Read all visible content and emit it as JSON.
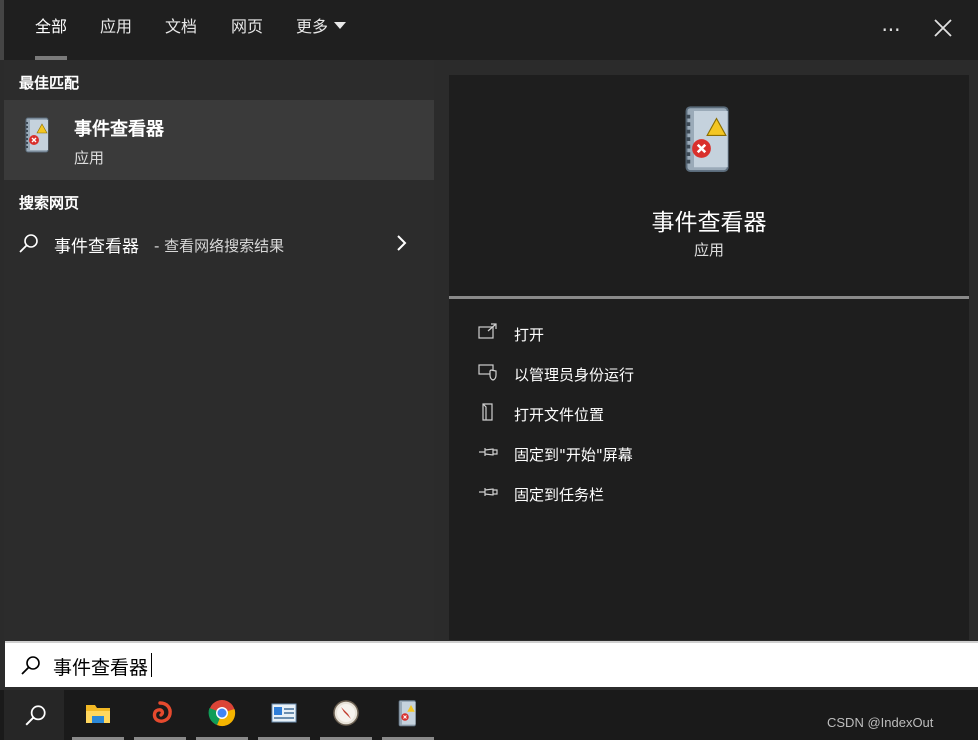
{
  "tabs": [
    {
      "label": "全部"
    },
    {
      "label": "应用"
    },
    {
      "label": "文档"
    },
    {
      "label": "网页"
    },
    {
      "label": "更多"
    }
  ],
  "top_actions": {
    "more_icon": "more-dots-icon",
    "close_icon": "close-icon",
    "more_glyph": "···",
    "close_glyph": "✕"
  },
  "left": {
    "best_match_heading": "最佳匹配",
    "best_match": {
      "title": "事件查看器",
      "subtitle": "应用",
      "icon": "event-viewer-icon"
    },
    "web_heading": "搜索网页",
    "web_result": {
      "title": "事件查看器",
      "subtitle": "- 查看网络搜索结果"
    }
  },
  "detail": {
    "title": "事件查看器",
    "subtitle": "应用",
    "actions": [
      {
        "label": "打开",
        "icon": "open-icon"
      },
      {
        "label": "以管理员身份运行",
        "icon": "admin-shield-icon"
      },
      {
        "label": "打开文件位置",
        "icon": "file-location-icon"
      },
      {
        "label": "固定到\"开始\"屏幕",
        "icon": "pin-icon"
      },
      {
        "label": "固定到任务栏",
        "icon": "pin-icon"
      }
    ]
  },
  "search": {
    "value": "事件查看器"
  },
  "taskbar": {
    "apps": [
      "file-explorer-icon",
      "spiral-app-icon",
      "chrome-icon",
      "control-panel-icon",
      "compass-app-icon",
      "event-viewer-icon"
    ],
    "watermark": "CSDN @IndexOut"
  }
}
